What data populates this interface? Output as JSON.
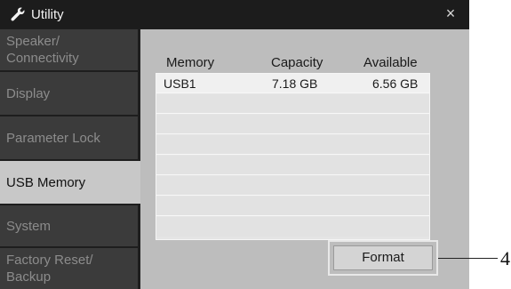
{
  "window": {
    "title": "Utility",
    "icon": "wrench-icon",
    "close_symbol": "×"
  },
  "sidebar": {
    "items": [
      {
        "label": "Speaker/\nConnectivity",
        "active": false
      },
      {
        "label": "Display",
        "active": false
      },
      {
        "label": "Parameter Lock",
        "active": false
      },
      {
        "label": "USB Memory",
        "active": true
      },
      {
        "label": "System",
        "active": false
      },
      {
        "label": "Factory Reset/\nBackup",
        "active": false
      }
    ]
  },
  "table": {
    "headers": {
      "memory": "Memory",
      "capacity": "Capacity",
      "available": "Available"
    },
    "rows": [
      {
        "memory": "USB1",
        "capacity": "7.18 GB",
        "available": "6.56 GB",
        "selected": true
      }
    ]
  },
  "buttons": {
    "format": "Format"
  },
  "callout": {
    "number": "4"
  },
  "colors": {
    "panel": "#bdbdbd",
    "sidebar_inactive": "#3b3b3b",
    "sidebar_active": "#c8c8c8",
    "titlebar": "#1c1c1c"
  }
}
